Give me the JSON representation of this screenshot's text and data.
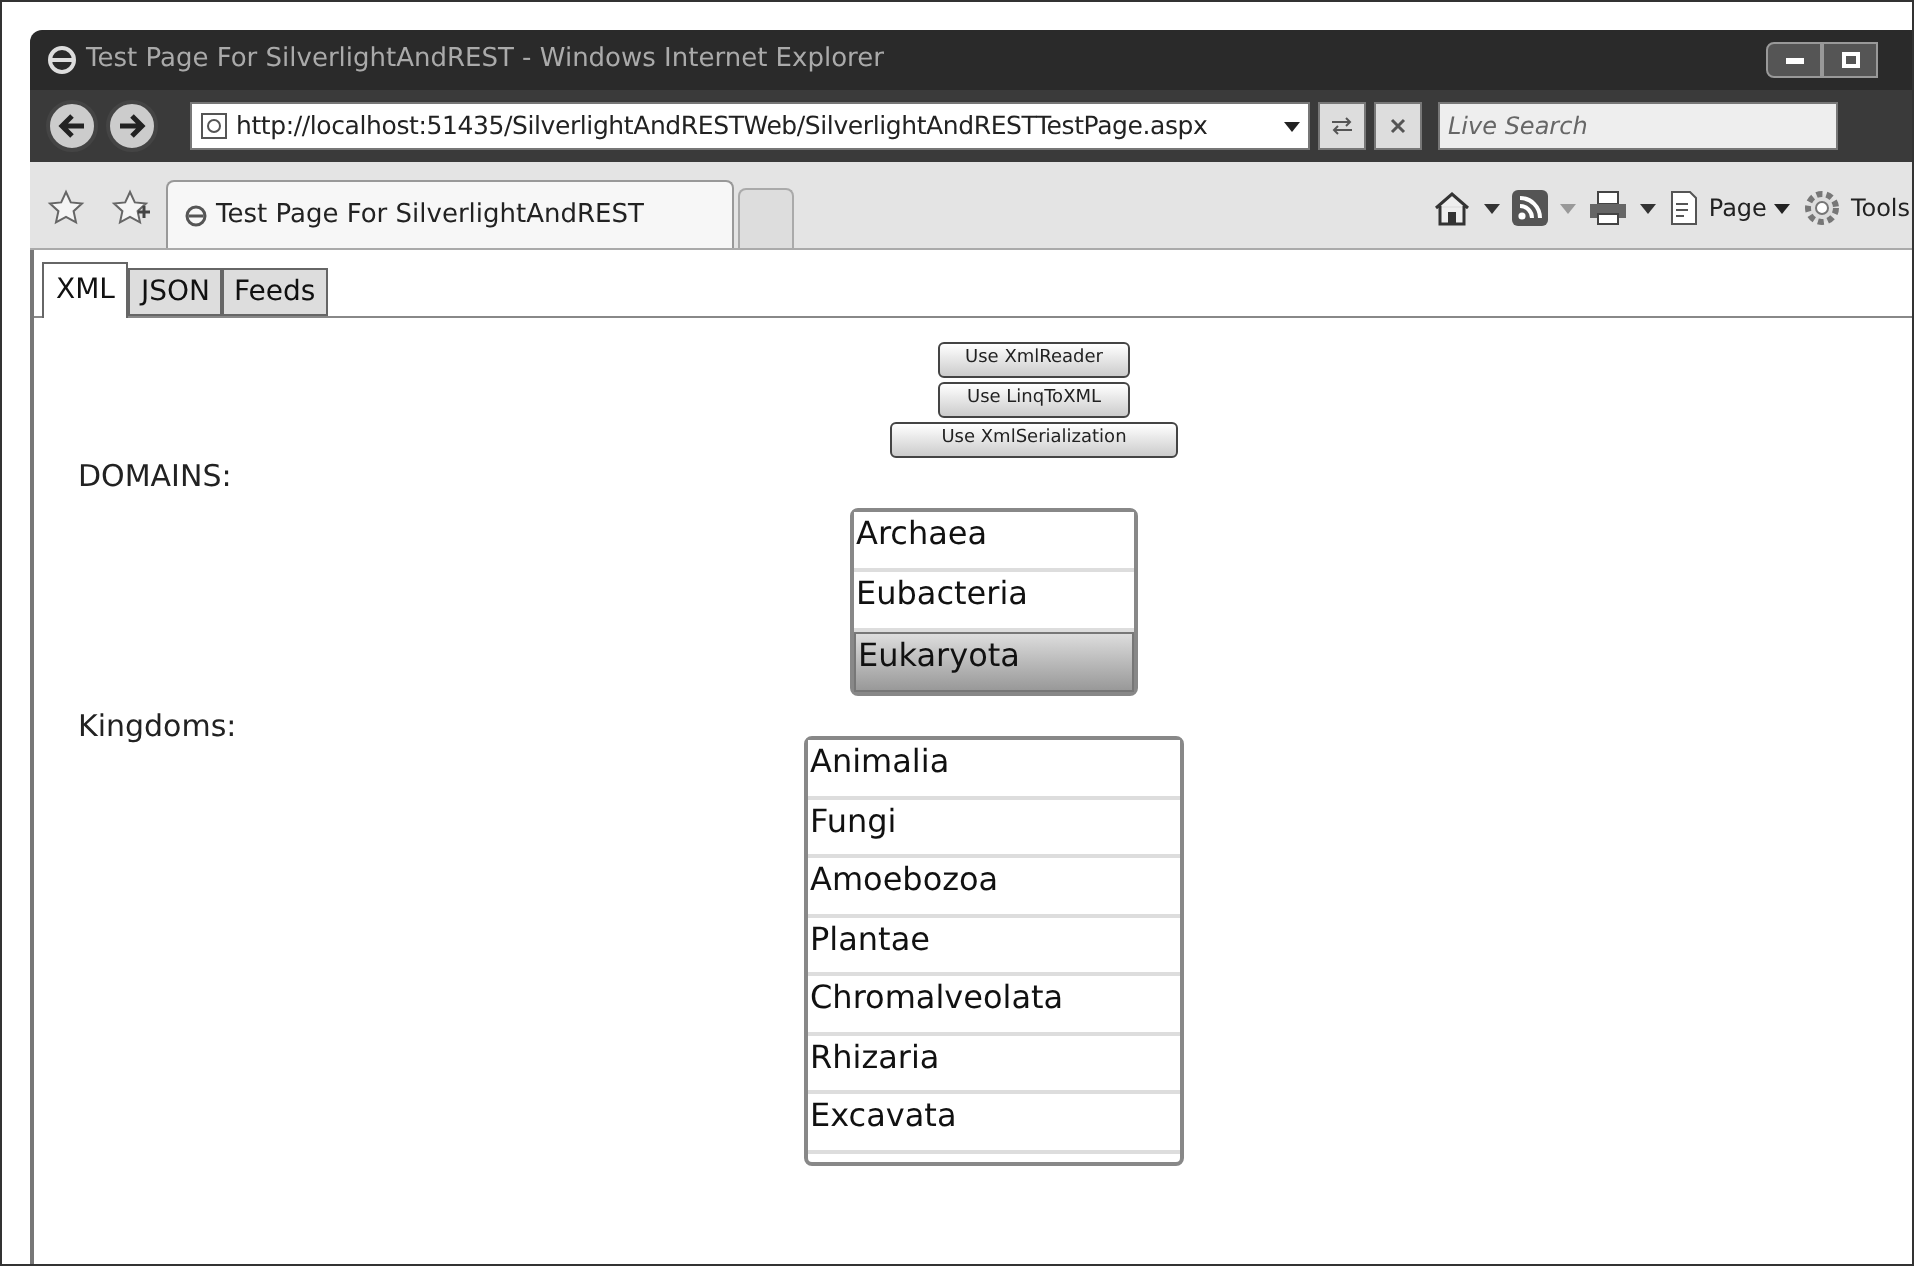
{
  "window": {
    "title": "Test Page For SilverlightAndREST - Windows Internet Explorer"
  },
  "address_bar": {
    "url": "http://localhost:51435/SilverlightAndRESTWeb/SilverlightAndRESTTestPage.aspx"
  },
  "search": {
    "placeholder": "Live Search"
  },
  "browser_tabs": [
    {
      "label": "Test Page For SilverlightAndREST",
      "selected": true
    }
  ],
  "command_bar": {
    "page": "Page",
    "tools": "Tools"
  },
  "tabs": [
    {
      "label": "XML",
      "selected": true
    },
    {
      "label": "JSON",
      "selected": false
    },
    {
      "label": "Feeds",
      "selected": false
    }
  ],
  "buttons": [
    {
      "label": "Use XmlReader"
    },
    {
      "label": "Use LinqToXML"
    },
    {
      "label": "Use XmlSerialization"
    }
  ],
  "domains": {
    "label": "DOMAINS:",
    "items": [
      {
        "label": "Archaea",
        "selected": false
      },
      {
        "label": "Eubacteria",
        "selected": false
      },
      {
        "label": "Eukaryota",
        "selected": true
      }
    ]
  },
  "kingdoms": {
    "label": "Kingdoms:",
    "items": [
      {
        "label": "Animalia",
        "selected": false
      },
      {
        "label": "Fungi",
        "selected": false
      },
      {
        "label": "Amoebozoa",
        "selected": false
      },
      {
        "label": "Plantae",
        "selected": false
      },
      {
        "label": "Chromalveolata",
        "selected": false
      },
      {
        "label": "Rhizaria",
        "selected": false
      },
      {
        "label": "Excavata",
        "selected": false
      }
    ]
  }
}
